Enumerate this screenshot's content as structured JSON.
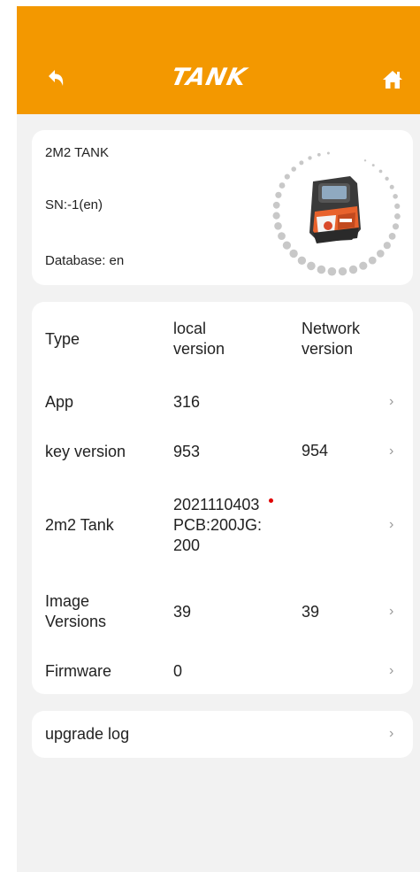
{
  "header": {
    "title": "TANK",
    "back_icon": "back-arrow-icon",
    "home_icon": "home-icon",
    "background": "#f39800"
  },
  "device": {
    "name": "2M2 TANK",
    "sn": "SN:-1(en)",
    "database": "Database: en",
    "image": "tank-machine-icon"
  },
  "versions": {
    "headers": {
      "type": "Type",
      "local": "local version",
      "network": "Network version"
    },
    "rows": [
      {
        "type": "App",
        "local": "316",
        "network": ""
      },
      {
        "type": "key version",
        "local": "953",
        "network": "954"
      },
      {
        "type": "2m2 Tank",
        "local": "2021110403 PCB:200JG: 200",
        "network": "",
        "update_dot": "#e00000"
      },
      {
        "type": "Image Versions",
        "local": "39",
        "network": "39"
      },
      {
        "type": "Firmware",
        "local": "0",
        "network": ""
      }
    ],
    "chevron": "›"
  },
  "log": {
    "label": "upgrade log",
    "chevron": "›"
  }
}
